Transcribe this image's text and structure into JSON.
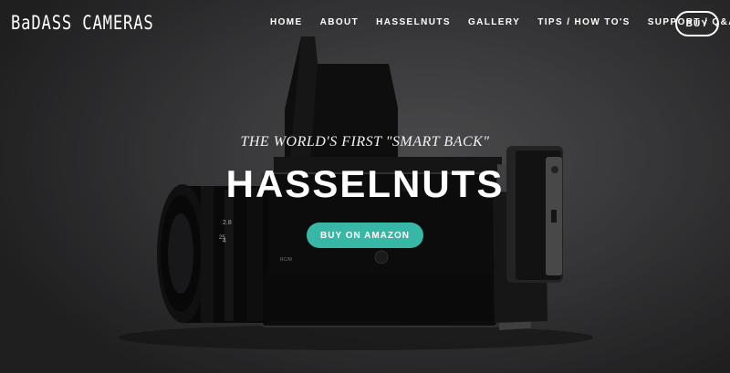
{
  "header": {
    "logo_text": "BaDASS CAMERAS",
    "nav": [
      {
        "label": "HOME"
      },
      {
        "label": "ABOUT"
      },
      {
        "label": "HASSELNUTS"
      },
      {
        "label": "GALLERY"
      },
      {
        "label": "TIPS / HOW TO'S"
      },
      {
        "label": "SUPPORT / Q&A"
      }
    ],
    "buy_label": "BUY"
  },
  "hero": {
    "tagline": "THE WORLD'S FIRST \"SMART BACK\"",
    "headline": "HASSELNUTS",
    "cta_label": "BUY ON AMAZON",
    "lens_marks": [
      "2.8",
      "4",
      "25"
    ],
    "back_plate_text": "RC/M",
    "image_subject": "medium-format-camera-photo"
  },
  "colors": {
    "cta": "#37b8a6",
    "text": "#ffffff"
  }
}
